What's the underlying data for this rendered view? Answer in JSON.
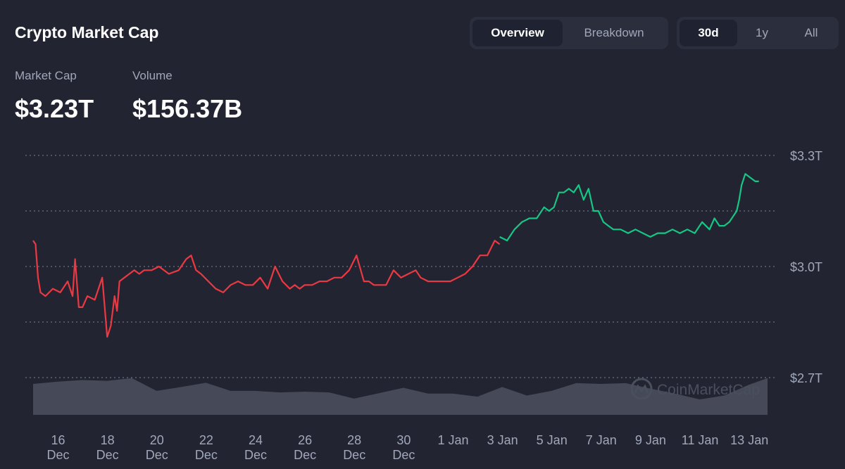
{
  "header": {
    "title": "Crypto Market Cap",
    "view_tabs": [
      {
        "label": "Overview",
        "active": true
      },
      {
        "label": "Breakdown",
        "active": false
      }
    ],
    "range_tabs": [
      {
        "label": "30d",
        "active": true
      },
      {
        "label": "1y",
        "active": false
      },
      {
        "label": "All",
        "active": false
      }
    ]
  },
  "stats": {
    "market_cap_label": "Market Cap",
    "market_cap_value": "$3.23T",
    "volume_label": "Volume",
    "volume_value": "$156.37B"
  },
  "watermark": "CoinMarketCap",
  "colors": {
    "background": "#222531",
    "up": "#16c784",
    "down": "#ea3943",
    "volume": "#4b505f",
    "grid": "#6b7080",
    "muted_text": "#a1a7bb"
  },
  "chart_data": {
    "type": "line",
    "title": "",
    "xlabel": "",
    "ylabel": "",
    "ylim": [
      2.7,
      3.3
    ],
    "y_unit": "T USD",
    "y_ticks": [
      "$3.3T",
      "$3.0T",
      "$2.7T"
    ],
    "y_tick_values": [
      3.3,
      3.0,
      2.7
    ],
    "grid_values": [
      3.3,
      3.15,
      3.0,
      2.85,
      2.7
    ],
    "grid": true,
    "x_ticks": [
      {
        "day": "16",
        "month": "Dec"
      },
      {
        "day": "18",
        "month": "Dec"
      },
      {
        "day": "20",
        "month": "Dec"
      },
      {
        "day": "22",
        "month": "Dec"
      },
      {
        "day": "24",
        "month": "Dec"
      },
      {
        "day": "26",
        "month": "Dec"
      },
      {
        "day": "28",
        "month": "Dec"
      },
      {
        "day": "30",
        "month": "Dec"
      },
      {
        "day": "1 Jan",
        "month": ""
      },
      {
        "day": "3 Jan",
        "month": ""
      },
      {
        "day": "5 Jan",
        "month": ""
      },
      {
        "day": "7 Jan",
        "month": ""
      },
      {
        "day": "9 Jan",
        "month": ""
      },
      {
        "day": "11 Jan",
        "month": ""
      },
      {
        "day": "13 Jan",
        "month": ""
      }
    ],
    "x_range_days": [
      -0.5,
      29.25
    ],
    "x_tick_days": [
      0,
      2,
      4,
      6,
      8,
      10,
      12,
      14,
      16,
      18,
      20,
      22,
      24,
      26,
      28
    ],
    "series": [
      {
        "color": "down",
        "x": [
          -0.5,
          -0.4,
          -0.3,
          -0.2,
          0,
          0.3,
          0.6,
          0.9,
          1.1,
          1.2,
          1.35,
          1.5,
          1.7,
          2.0,
          2.3,
          2.5,
          2.65,
          2.8,
          2.9,
          3.0,
          3.2,
          3.4,
          3.6,
          3.8,
          4.0,
          4.3,
          4.6,
          5.0,
          5.4,
          5.7,
          5.9,
          6.1,
          6.3,
          6.6,
          6.9,
          7.2,
          7.5,
          7.8,
          8.1,
          8.4,
          8.7,
          9.0,
          9.3,
          9.6,
          9.9,
          10.1,
          10.3,
          10.5,
          10.8,
          11.1,
          11.4,
          11.7,
          12.0,
          12.3,
          12.6,
          12.9,
          13.1,
          13.3,
          13.5,
          13.8,
          14.1,
          14.4,
          14.7,
          15.0,
          15.2,
          15.5,
          15.8,
          16.1,
          16.4,
          16.7,
          17.0,
          17.3,
          17.6,
          17.9,
          18.2,
          18.4
        ],
        "y": [
          3.07,
          3.06,
          2.97,
          2.93,
          2.92,
          2.94,
          2.93,
          2.96,
          2.92,
          3.02,
          2.89,
          2.89,
          2.92,
          2.91,
          2.97,
          2.81,
          2.84,
          2.92,
          2.88,
          2.96,
          2.97,
          2.98,
          2.99,
          2.98,
          2.99,
          2.99,
          3.0,
          2.98,
          2.99,
          3.02,
          3.03,
          2.99,
          2.98,
          2.96,
          2.94,
          2.93,
          2.95,
          2.96,
          2.95,
          2.95,
          2.97,
          2.94,
          3.0,
          2.96,
          2.94,
          2.95,
          2.94,
          2.95,
          2.95,
          2.96,
          2.96,
          2.97,
          2.97,
          2.99,
          3.03,
          2.96,
          2.96,
          2.95,
          2.95,
          2.95,
          2.99,
          2.97,
          2.98,
          2.99,
          2.97,
          2.96,
          2.96,
          2.96,
          2.96,
          2.97,
          2.98,
          3.0,
          3.03,
          3.03,
          3.07,
          3.06
        ]
      },
      {
        "color": "up",
        "x": [
          18.4,
          18.7,
          19.0,
          19.3,
          19.6,
          19.9,
          20.2,
          20.4,
          20.6,
          20.8,
          21.0,
          21.2,
          21.4,
          21.6,
          21.8,
          22.0,
          22.2,
          22.4,
          22.6,
          22.8,
          23.0,
          23.3,
          23.6,
          23.9,
          24.2,
          24.5,
          24.8,
          25.1,
          25.4,
          25.7,
          26.0,
          26.3,
          26.6,
          26.9,
          27.1,
          27.3,
          27.5,
          27.7,
          27.9,
          28.0,
          28.1,
          28.2,
          28.35,
          28.55,
          28.75,
          28.9
        ],
        "y": [
          3.08,
          3.07,
          3.1,
          3.12,
          3.13,
          3.13,
          3.16,
          3.15,
          3.16,
          3.2,
          3.2,
          3.21,
          3.2,
          3.22,
          3.18,
          3.21,
          3.15,
          3.15,
          3.12,
          3.11,
          3.1,
          3.1,
          3.09,
          3.1,
          3.09,
          3.08,
          3.09,
          3.09,
          3.1,
          3.09,
          3.1,
          3.09,
          3.12,
          3.1,
          3.13,
          3.11,
          3.11,
          3.12,
          3.14,
          3.15,
          3.18,
          3.22,
          3.25,
          3.24,
          3.23,
          3.23
        ]
      }
    ],
    "volume_bars": {
      "note": "relative volume profile (unlabeled)",
      "x": [
        -0.5,
        0.5,
        1.5,
        2.5,
        3.5,
        4.5,
        5.5,
        6.5,
        7.5,
        8.5,
        9.5,
        10.5,
        11.5,
        12.5,
        13.5,
        14.5,
        15.5,
        16.5,
        17.5,
        18.5,
        19.5,
        20.5,
        21.5,
        22.5,
        23.5,
        24.5,
        25.5,
        26.5,
        27.5,
        28.5,
        29.25
      ],
      "values": [
        0.8,
        0.86,
        0.9,
        0.88,
        0.95,
        0.62,
        0.72,
        0.83,
        0.62,
        0.62,
        0.58,
        0.6,
        0.58,
        0.42,
        0.56,
        0.7,
        0.55,
        0.55,
        0.47,
        0.72,
        0.5,
        0.62,
        0.82,
        0.8,
        0.82,
        0.68,
        0.55,
        0.4,
        0.5,
        0.78,
        0.95
      ]
    }
  }
}
